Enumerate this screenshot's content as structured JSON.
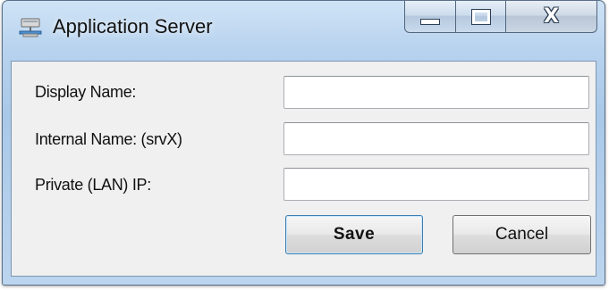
{
  "window": {
    "title": "Application Server",
    "icon": "server-network-icon",
    "caption_buttons": {
      "minimize": "minimize-icon",
      "maximize": "maximize-icon",
      "close": "X"
    }
  },
  "form": {
    "fields": [
      {
        "label": "Display Name:",
        "value": ""
      },
      {
        "label": "Internal Name: (srvX)",
        "value": ""
      },
      {
        "label": "Private (LAN) IP:",
        "value": ""
      }
    ],
    "save_label": "Save",
    "cancel_label": "Cancel"
  },
  "colors": {
    "accent": "#3c7fb1",
    "frame": "#b7d2ee",
    "client_bg": "#f0f0f0"
  }
}
